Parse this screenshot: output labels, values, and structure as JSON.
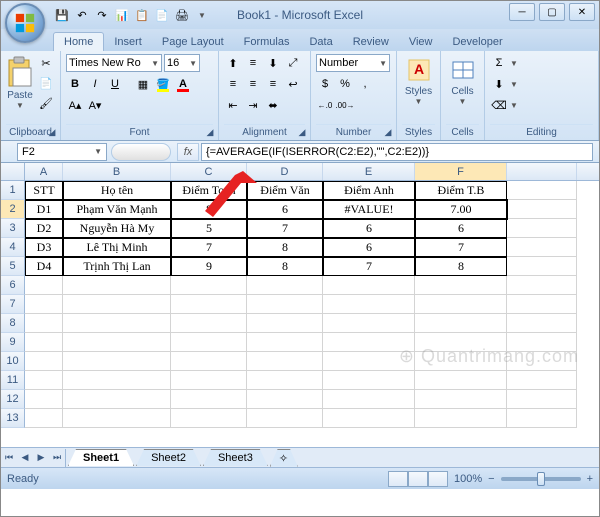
{
  "title": "Book1 - Microsoft Excel",
  "qat": {
    "save": "💾",
    "undo": "↶",
    "redo": "↷"
  },
  "tabs": [
    "Home",
    "Insert",
    "Page Layout",
    "Formulas",
    "Data",
    "Review",
    "View",
    "Developer"
  ],
  "ribbon": {
    "clipboard": {
      "label": "Clipboard",
      "paste": "Paste"
    },
    "font": {
      "label": "Font",
      "family": "Times New Ro",
      "size": "16",
      "bold": "B",
      "italic": "I",
      "underline": "U"
    },
    "alignment": {
      "label": "Alignment"
    },
    "number": {
      "label": "Number",
      "format": "Number",
      "currency": "$",
      "percent": "%",
      "comma": ",",
      "inc": "←.0",
      "dec": ".00→"
    },
    "styles": {
      "label": "Styles",
      "btn": "Styles"
    },
    "cells": {
      "label": "Cells",
      "btn": "Cells"
    },
    "editing": {
      "label": "Editing",
      "sigma": "Σ"
    }
  },
  "namebox": "F2",
  "fx": "fx",
  "formula": "{=AVERAGE(IF(ISERROR(C2:E2),\"\",C2:E2))}",
  "columns": [
    "A",
    "B",
    "C",
    "D",
    "E",
    "F"
  ],
  "headers": {
    "stt": "STT",
    "hoten": "Họ tên",
    "toan": "Điểm Toán",
    "van": "Điểm Văn",
    "anh": "Điểm Anh",
    "tb": "Điểm T.B"
  },
  "rows": [
    {
      "stt": "D1",
      "hoten": "Phạm Văn Mạnh",
      "toan": "8",
      "van": "6",
      "anh": "#VALUE!",
      "tb": "7.00"
    },
    {
      "stt": "D2",
      "hoten": "Nguyễn Hà My",
      "toan": "5",
      "van": "7",
      "anh": "6",
      "tb": "6"
    },
    {
      "stt": "D3",
      "hoten": "Lê Thị Minh",
      "toan": "7",
      "van": "8",
      "anh": "6",
      "tb": "7"
    },
    {
      "stt": "D4",
      "hoten": "Trịnh Thị Lan",
      "toan": "9",
      "van": "8",
      "anh": "7",
      "tb": "8"
    }
  ],
  "sheets": [
    "Sheet1",
    "Sheet2",
    "Sheet3"
  ],
  "status": {
    "ready": "Ready",
    "zoom": "100%",
    "minus": "−",
    "plus": "+"
  },
  "watermark": "Quantrimang.com"
}
